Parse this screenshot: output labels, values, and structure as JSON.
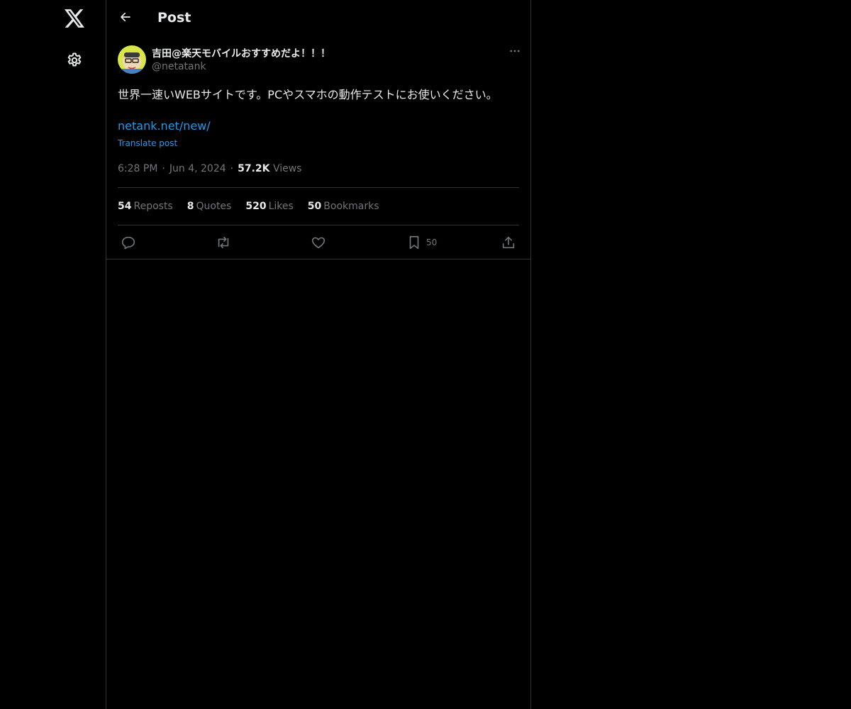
{
  "nav": {
    "items": [
      {
        "icon": "x-logo-icon"
      },
      {
        "icon": "gear-icon"
      }
    ]
  },
  "header": {
    "title": "Post"
  },
  "post": {
    "author": {
      "display_name": "吉田@楽天モバイルおすすめだよ！！！",
      "handle": "@netatank"
    },
    "text": "世界一速いWEBサイトです。PCやスマホの動作テストにお使いください。",
    "link": "netank.net/new/",
    "translate_label": "Translate post",
    "time": "6:28 PM",
    "date": "Jun 4, 2024",
    "views_count": "57.2K",
    "views_label": "Views",
    "stats": {
      "reposts_count": "54",
      "reposts_label": "Reposts",
      "quotes_count": "8",
      "quotes_label": "Quotes",
      "likes_count": "520",
      "likes_label": "Likes",
      "bookmarks_count": "50",
      "bookmarks_label": "Bookmarks"
    },
    "actions": {
      "bookmark_count": "50"
    }
  },
  "colors": {
    "background": "#000000",
    "text": "#e7e9ea",
    "secondary_text": "#71767b",
    "link": "#1d9bf0",
    "border": "#2f3336"
  }
}
